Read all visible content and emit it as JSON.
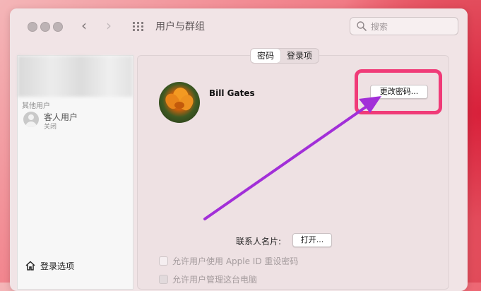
{
  "window": {
    "title": "用户与群组",
    "search_placeholder": "搜索"
  },
  "sidebar": {
    "other_users_label": "其他用户",
    "guest_user": {
      "name": "客人用户",
      "status": "关闭"
    },
    "login_options_label": "登录选项"
  },
  "tabs": [
    {
      "label": "密码",
      "active": true
    },
    {
      "label": "登录项",
      "active": false
    }
  ],
  "user": {
    "name": "Bill Gates",
    "change_password_button": "更改密码..."
  },
  "contact": {
    "label": "联系人名片:",
    "open_button": "打开..."
  },
  "checkboxes": [
    {
      "label": "允许用户使用 Apple ID 重设密码",
      "checked": false
    },
    {
      "label": "允许用户管理这台电脑",
      "checked": true
    }
  ],
  "annotation": {
    "highlight_color": "#f03b78",
    "arrow_color": "#a22fd8"
  }
}
